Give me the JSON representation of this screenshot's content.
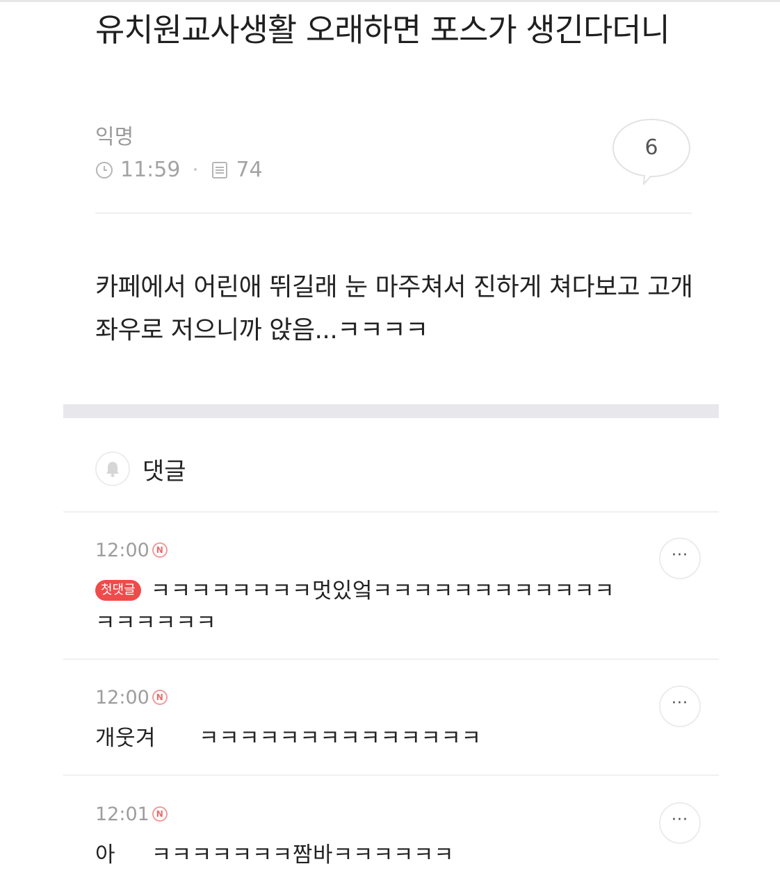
{
  "post": {
    "title": "유치원교사생활 오래하면 포스가 생긴다더니",
    "author": "익명",
    "time": "11:59",
    "views": "74",
    "comment_count": "6",
    "body": "카페에서 어린애 뛰길래 눈 마주쳐서 진하게 쳐다보고 고개 좌우로 저으니까 앉음...ㅋㅋㅋㅋ"
  },
  "comments_section": {
    "label": "댓글"
  },
  "comments": [
    {
      "time": "12:00",
      "new_badge": "N",
      "first_badge": "첫댓글",
      "text": "ㅋㅋㅋㅋㅋㅋㅋㅋ멋있엌ㅋㅋㅋㅋㅋㅋㅋㅋㅋㅋㅋㅋㅋㅋㅋㅋㅋㅋ",
      "more": "···"
    },
    {
      "time": "12:00",
      "new_badge": "N",
      "text": "개웃겨      ㅋㅋㅋㅋㅋㅋㅋㅋㅋㅋㅋㅋㅋㅋ",
      "more": "···"
    },
    {
      "time": "12:01",
      "new_badge": "N",
      "text": "아     ㅋㅋㅋㅋㅋㅋㅋ짬바ㅋㅋㅋㅋㅋㅋ",
      "more": "···"
    }
  ],
  "icons": {
    "clock": "clock-icon",
    "views": "document-icon",
    "bubble": "speech-bubble-icon",
    "bell": "bell-icon"
  }
}
